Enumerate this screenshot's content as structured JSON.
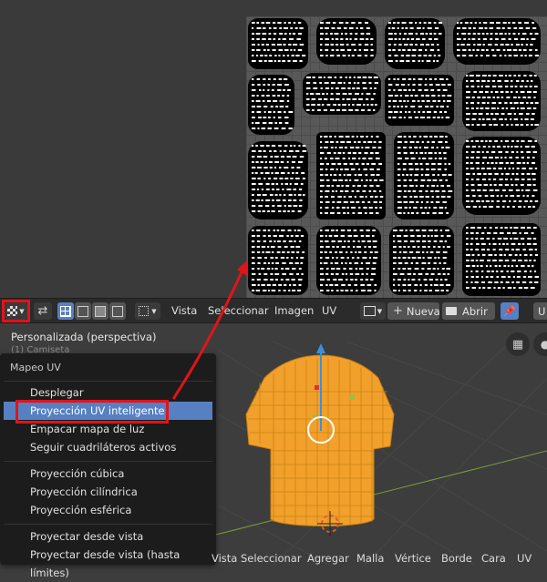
{
  "uv_header": {
    "menus": [
      "Vista",
      "Seleccionar",
      "Imagen",
      "UV"
    ],
    "new_label": "Nueva",
    "open_label": "Abrir",
    "trailing_text": "U"
  },
  "viewport": {
    "title": "Personalizada (perspectiva)",
    "subtitle": "(1) Camiseta"
  },
  "uv_menu": {
    "title": "Mapeo UV",
    "groups": [
      [
        "Desplegar",
        "Proyección UV inteligente",
        "Empacar mapa de luz",
        "Seguir cuadriláteros activos"
      ],
      [
        "Proyección cúbica",
        "Proyección cilíndrica",
        "Proyección esférica"
      ],
      [
        "Proyectar desde vista",
        "Proyectar desde vista (hasta límites)"
      ]
    ],
    "active_item": "Proyección UV inteligente"
  },
  "viewport_header": {
    "menus": [
      "Vista",
      "Seleccionar",
      "Agregar",
      "Malla",
      "Vértice",
      "Borde",
      "Cara",
      "UV"
    ]
  },
  "colors": {
    "annotation": "#e0141a",
    "menu_highlight": "#5680c2",
    "mesh": "#f5a623"
  }
}
